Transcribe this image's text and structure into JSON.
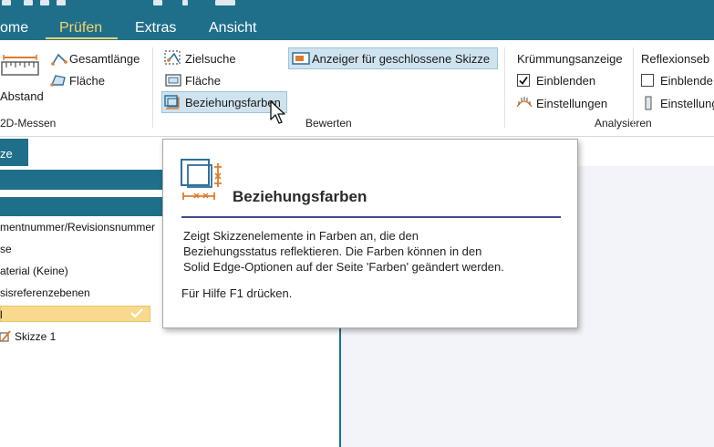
{
  "ribbon": {
    "tabs": [
      "ome",
      "Prüfen",
      "Extras",
      "Ansicht"
    ],
    "active_tab": "Prüfen",
    "messen": {
      "gesamtlaenge": "Gesamtlänge",
      "flaeche": "Fläche",
      "abstand": "Abstand",
      "group_label": "2D-Messen"
    },
    "bewerten": {
      "zielsuche": "Zielsuche",
      "flaeche": "Fläche",
      "beziehungsfarben": "Beziehungsfarben",
      "anzeiger": "Anzeiger für geschlossene Skizze",
      "group_label": "Bewerten"
    },
    "analysieren": {
      "kruemmungsanzeige": "Krümmungsanzeige",
      "einblenden": "Einblenden",
      "einstellungen": "Einstellungen",
      "group_label": "Analysieren"
    },
    "reflexion": {
      "title": "Reflexionseb",
      "einblenden": "Einblende",
      "einstellungen": "Einstellung"
    }
  },
  "pane": {
    "tab_label": "ze",
    "items": [
      "mentnummer/Revisionsnummer",
      "se",
      "aterial (Keine)",
      "sisreferenzebenen",
      "l",
      "Skizze 1"
    ]
  },
  "tooltip": {
    "title": "Beziehungsfarben",
    "body": "Zeigt Skizzenelemente in Farben an, die den\nBeziehungsstatus reflektieren. Die Farben können in den\nSolid Edge-Optionen auf der Seite 'Farben' geändert werden.",
    "help": "Für Hilfe F1 drücken."
  },
  "colors": {
    "ribbon_bg": "#1f6f8b",
    "active_tab": "#f5d36b",
    "selection": "#f9d98d",
    "highlight": "#cfe3ef",
    "icon_orange": "#e07b2a",
    "icon_blue": "#2f6f9b"
  },
  "icons": {
    "ruler": "ruler-icon",
    "area": "area-icon",
    "target": "target-search-icon",
    "relationship": "relationship-colors-icon",
    "closed_sketch": "closed-sketch-icon",
    "checkbox_checked": "checkbox-checked-icon",
    "curvature": "curvature-settings-icon",
    "sketch": "sketch-icon",
    "cursor": "mouse-cursor-icon"
  }
}
